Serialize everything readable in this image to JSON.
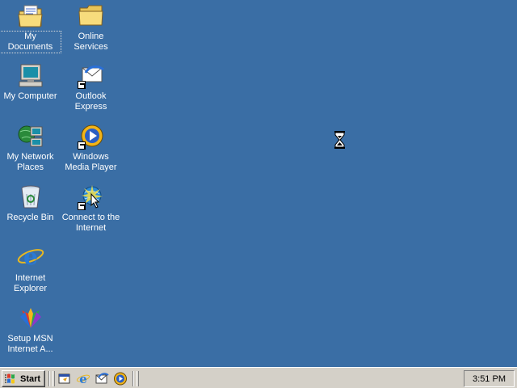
{
  "desktop": {
    "background_color": "#3a6ea5",
    "icons": [
      {
        "label": "My Documents",
        "icon": "my-documents-icon"
      },
      {
        "label": "Online\nServices",
        "icon": "folder-icon"
      },
      {
        "label": "My Computer",
        "icon": "my-computer-icon"
      },
      {
        "label": "Outlook\nExpress",
        "icon": "outlook-express-icon"
      },
      {
        "label": "My Network\nPlaces",
        "icon": "network-places-icon"
      },
      {
        "label": "Windows\nMedia Player",
        "icon": "media-player-icon"
      },
      {
        "label": "Recycle Bin",
        "icon": "recycle-bin-icon"
      },
      {
        "label": "Connect to the\nInternet",
        "icon": "connect-internet-icon"
      },
      {
        "label": "Internet\nExplorer",
        "icon": "internet-explorer-icon"
      },
      {
        "label": "Setup MSN\nInternet A...",
        "icon": "msn-setup-icon"
      }
    ]
  },
  "cursor": {
    "icon": "hourglass-icon"
  },
  "taskbar": {
    "start_label": "Start",
    "quick_launch": [
      "show-desktop-icon",
      "internet-explorer-icon",
      "outlook-express-icon",
      "media-player-icon"
    ],
    "clock": "3:51 PM"
  }
}
